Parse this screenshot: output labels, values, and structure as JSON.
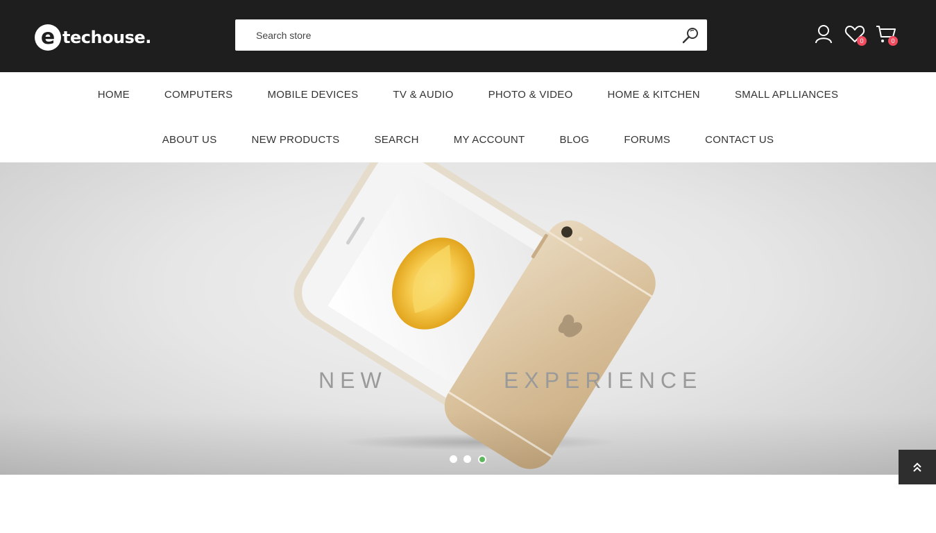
{
  "header": {
    "logo_letter": "e",
    "logo_text": "techouse.",
    "search_placeholder": "Search store",
    "wishlist_count": "0",
    "cart_count": "0",
    "icon_color": "#ffffff",
    "background": "#1e1e1e",
    "badge_color": "#f04b5e"
  },
  "nav": {
    "row1": [
      "HOME",
      "COMPUTERS",
      "MOBILE DEVICES",
      "TV & AUDIO",
      "PHOTO & VIDEO",
      "HOME & KITCHEN",
      "SMALL APLLIANCES"
    ],
    "row2": [
      "ABOUT US",
      "NEW PRODUCTS",
      "SEARCH",
      "MY ACCOUNT",
      "BLOG",
      "FORUMS",
      "CONTACT US"
    ]
  },
  "hero": {
    "text_left": "NEW",
    "text_right": "EXPERIENCE",
    "slide_count": 3,
    "active_slide": 3,
    "accent_color": "#5cb85c"
  },
  "icons": {
    "search": "search-icon",
    "account": "user-icon",
    "wishlist": "heart-icon",
    "cart": "cart-icon",
    "back_to_top": "double-chevron-up-icon"
  }
}
